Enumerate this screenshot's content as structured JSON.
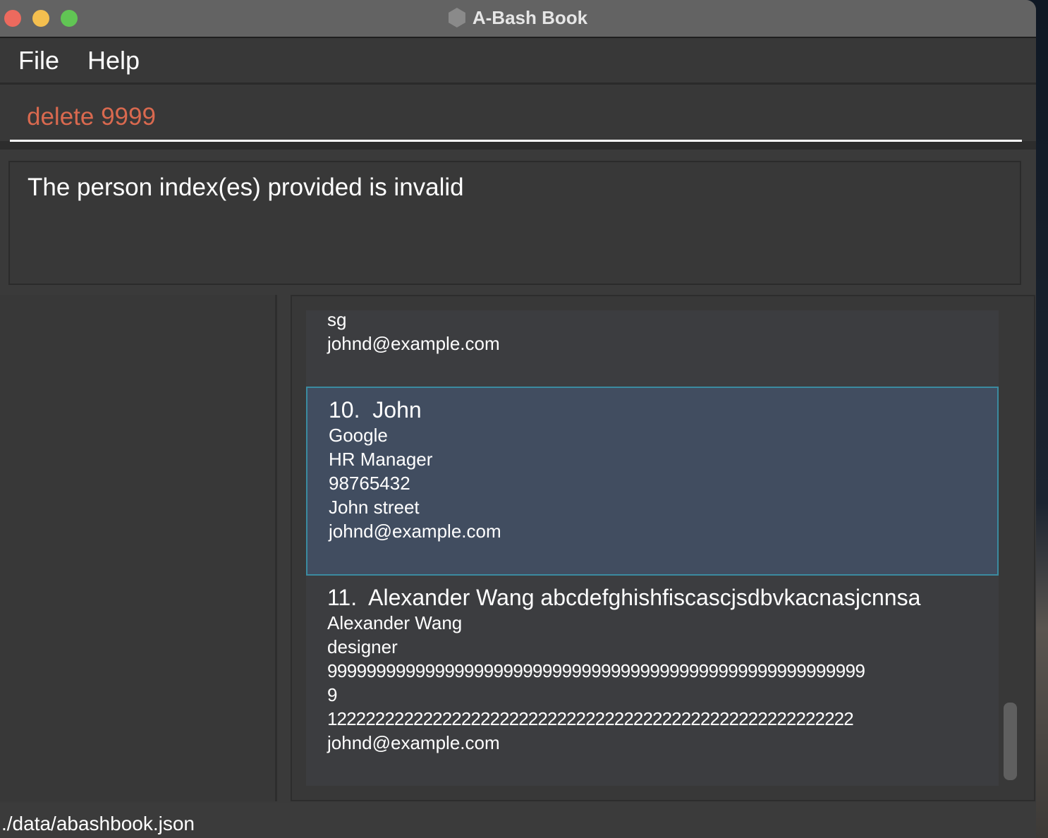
{
  "window": {
    "title": "A-Bash Book",
    "traffic_colors": {
      "close": "#ec6a5e",
      "minimize": "#f4bf4f",
      "maximize": "#61c554"
    }
  },
  "menu": [
    "File",
    "Help"
  ],
  "command": {
    "value": "delete 9999",
    "color": "#d9694f"
  },
  "result": {
    "message": "The person index(es) provided is invalid"
  },
  "persons": [
    {
      "lines": [
        "sg",
        "johnd@example.com"
      ]
    },
    {
      "index": "10.",
      "name": "John",
      "lines": [
        "Google",
        "HR Manager",
        "98765432",
        "John street",
        "johnd@example.com"
      ],
      "selected": true
    },
    {
      "index": "11.",
      "name": "Alexander Wang abcdefghishfiscascjsdbvkacnasjcnnsa",
      "lines": [
        "Alexander Wang",
        "designer",
        "9999999999999999999999999999999999999999999999999999999",
        "9",
        "1222222222222222222222222222222222222222222222222222222",
        "johnd@example.com"
      ]
    }
  ],
  "status": {
    "path": "./data/abashbook.json"
  }
}
